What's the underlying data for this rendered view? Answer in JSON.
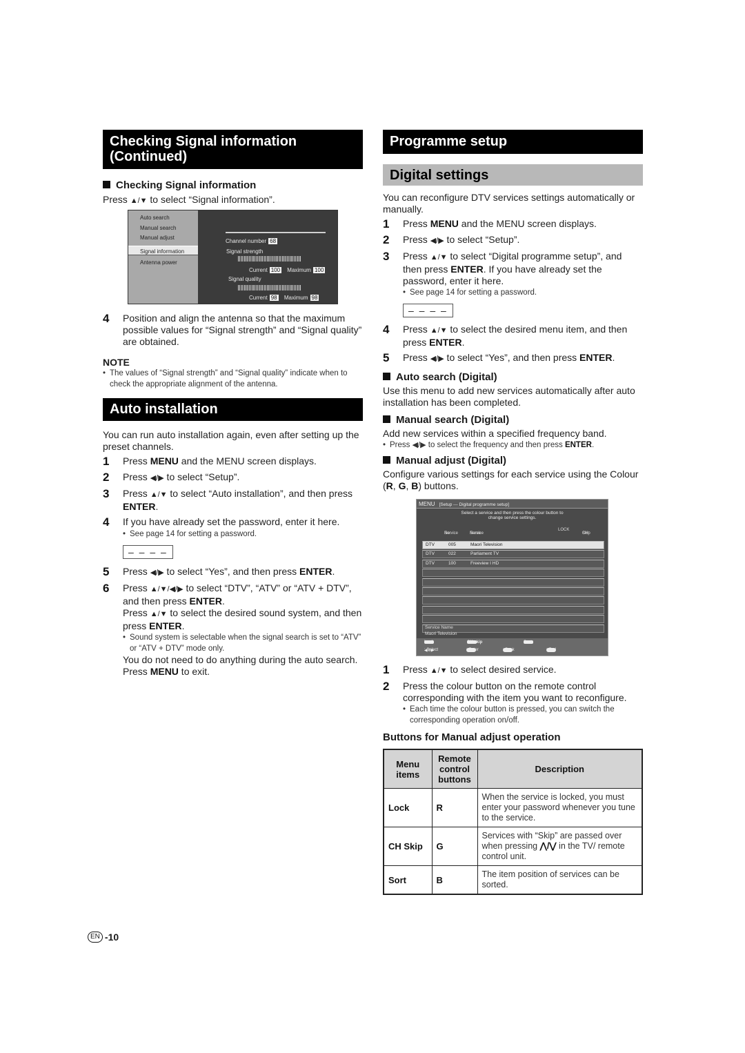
{
  "left": {
    "signal_banner": [
      "Checking Signal information",
      "(Continued)"
    ],
    "signal_subhead": "Checking Signal information",
    "signal_press": [
      "Press ",
      "▲/▼",
      " to select “Signal information”."
    ],
    "signal_screen": {
      "menu_items": [
        "Auto search",
        "Manual search",
        "Manual adjust",
        "Signal information",
        "Antenna power"
      ],
      "selected_index": 3,
      "channel_number_label": "Channel number",
      "channel_number": "68",
      "strength_label": "Signal strength",
      "quality_label": "Signal quality",
      "current_label": "Current",
      "maximum_label": "Maximum",
      "strength_current": "100",
      "strength_maximum": "100",
      "quality_current": "98",
      "quality_maximum": "98"
    },
    "step4_num": "4",
    "step4_text": "Position and align the antenna so that the maximum possible values for “Signal strength” and “Signal quality” are obtained.",
    "note_label": "NOTE",
    "note_text": "The values of “Signal strength” and “Signal quality” indicate when to check the appropriate alignment of the antenna.",
    "auto_banner": "Auto installation",
    "auto_intro": "You can run auto installation again, even after setting up the preset channels.",
    "auto_steps": [
      {
        "num": "1",
        "a": "Press ",
        "b": "MENU",
        "c": " and the MENU screen displays."
      },
      {
        "num": "2",
        "a": "Press ",
        "arrows": "◀/▶",
        "c": " to select “Setup”."
      },
      {
        "num": "3",
        "a": "Press ",
        "arrows": "▲/▼",
        "c": " to select “Auto installation”, and then press ",
        "b": "ENTER",
        "d": "."
      },
      {
        "num": "4",
        "a": "If you have already set the password, enter it here."
      },
      {
        "num": "5",
        "a": "Press ",
        "arrows": "◀/▶",
        "c": " to select “Yes”, and then press ",
        "b": "ENTER",
        "d": "."
      },
      {
        "num": "6",
        "a": "Press ",
        "arrows": "▲/▼/◀/▶",
        "c": " to select “DTV”, “ATV” or “ATV + DTV”, and then press ",
        "b": "ENTER",
        "d": "."
      }
    ],
    "step4_bullet": "See page 14 for setting a password.",
    "password_placeholder": "– – – –",
    "step6_more_a": "Press ",
    "step6_more_arrows": "▲/▼",
    "step6_more_c": " to select the desired sound system, and then press ",
    "step6_more_b": "ENTER",
    "step6_more_d": ".",
    "step6_bullet": "Sound system is selectable when the signal search is set to “ATV” or “ATV + DTV” mode only.",
    "step6_tail_a": "You do not need to do anything during the auto search. Press ",
    "step6_tail_b": "MENU",
    "step6_tail_c": " to exit."
  },
  "right": {
    "prog_banner": "Programme setup",
    "digital_banner": "Digital settings",
    "intro": "You can reconfigure DTV services settings automatically or manually.",
    "steps": [
      {
        "num": "1",
        "a": "Press ",
        "b": "MENU",
        "c": " and the MENU screen displays."
      },
      {
        "num": "2",
        "a": "Press ",
        "arrows": "◀/▶",
        "c": " to select “Setup”."
      },
      {
        "num": "3",
        "a": "Press ",
        "arrows": "▲/▼",
        "c": " to select “Digital programme setup”, and then press ",
        "b": "ENTER",
        "d": ". If you have already set the password, enter it here."
      },
      {
        "num": "4",
        "a": "Press ",
        "arrows": "▲/▼",
        "c": " to select the desired menu item, and then press ",
        "b": "ENTER",
        "d": "."
      },
      {
        "num": "5",
        "a": "Press ",
        "arrows": "◀/▶",
        "c": " to select “Yes”, and then press ",
        "b": "ENTER",
        "d": "."
      }
    ],
    "step3_bullet": "See page 14 for setting a password.",
    "password_placeholder": "– – – –",
    "auto_search_head": "Auto search (Digital)",
    "auto_search_text": "Use this menu to add new services automatically after auto installation has been completed.",
    "manual_search_head": "Manual search (Digital)",
    "manual_search_text": "Add new services within a specified frequency band.",
    "manual_search_bullet_a": "Press ",
    "manual_search_bullet_arrows": "◀/▶",
    "manual_search_bullet_c": " to select the frequency and then press ",
    "manual_search_bullet_b": "ENTER",
    "manual_search_bullet_d": ".",
    "manual_adjust_head": "Manual adjust (Digital)",
    "manual_adjust_text_a": "Configure various settings for each service using the Colour (",
    "manual_adjust_r": "R",
    "manual_adjust_sep1": ", ",
    "manual_adjust_g": "G",
    "manual_adjust_sep2": ", ",
    "manual_adjust_b": "B",
    "manual_adjust_text_c": ") buttons.",
    "dps_screen": {
      "menu_label": "MENU",
      "breadcrumb": "[Setup --- Digital programme setup]",
      "instruction": [
        "Select a service and then press the colour button to",
        "change service settings."
      ],
      "col_service_no": [
        "Service",
        "No."
      ],
      "col_service_name": [
        "Service",
        "Name"
      ],
      "col_lock": "LOCK",
      "col_skip": [
        "CH",
        "Skip"
      ],
      "rows": [
        {
          "type": "DTV",
          "no": "005",
          "name": "Maori Television"
        },
        {
          "type": "DTV",
          "no": "022",
          "name": "Parliament TV"
        },
        {
          "type": "DTV",
          "no": "100",
          "name": "Freeview I HD"
        }
      ],
      "selected_index": 0,
      "empty_rows": 7,
      "service_name_label": "Service Name",
      "service_name_value": "Maori Television",
      "footer": {
        "r_key": "R",
        "r_label": "Lock",
        "g_key": "G",
        "g_label": "CH skip",
        "b_key": "B",
        "b_label": "Sort",
        "select_glyph": "◀⇕▶",
        "select_label": ": Select",
        "enter_key": "ENTER",
        "enter_label": ": Enter",
        "return_key": "RETURN",
        "return_label": ": Back",
        "menu_key": "MENU",
        "menu_label": ": End"
      }
    },
    "after_steps": [
      {
        "num": "1",
        "a": "Press ",
        "arrows": "▲/▼",
        "c": " to select desired service."
      },
      {
        "num": "2",
        "a": "Press the colour button on the remote control corresponding with the item you want to reconfigure."
      }
    ],
    "after_bullet": "Each time the colour button is pressed, you can switch the corresponding operation on/off.",
    "table_title": "Buttons for Manual adjust operation",
    "table": {
      "headers": [
        "Menu items",
        "Remote control buttons",
        "Description"
      ],
      "rows": [
        {
          "item": "Lock",
          "button": "R",
          "desc": "When the service is locked, you must enter your password whenever you tune to the service."
        },
        {
          "item": "CH Skip",
          "button": "G",
          "desc_a": "Services with “Skip” are passed over when pressing ",
          "desc_glyph": "⋀/⋁",
          "desc_c": " in the TV/ remote control unit."
        },
        {
          "item": "Sort",
          "button": "B",
          "desc": "The item position of services can be sorted."
        }
      ]
    }
  },
  "footer": {
    "lang_badge": "EN",
    "page_number": "-10"
  }
}
